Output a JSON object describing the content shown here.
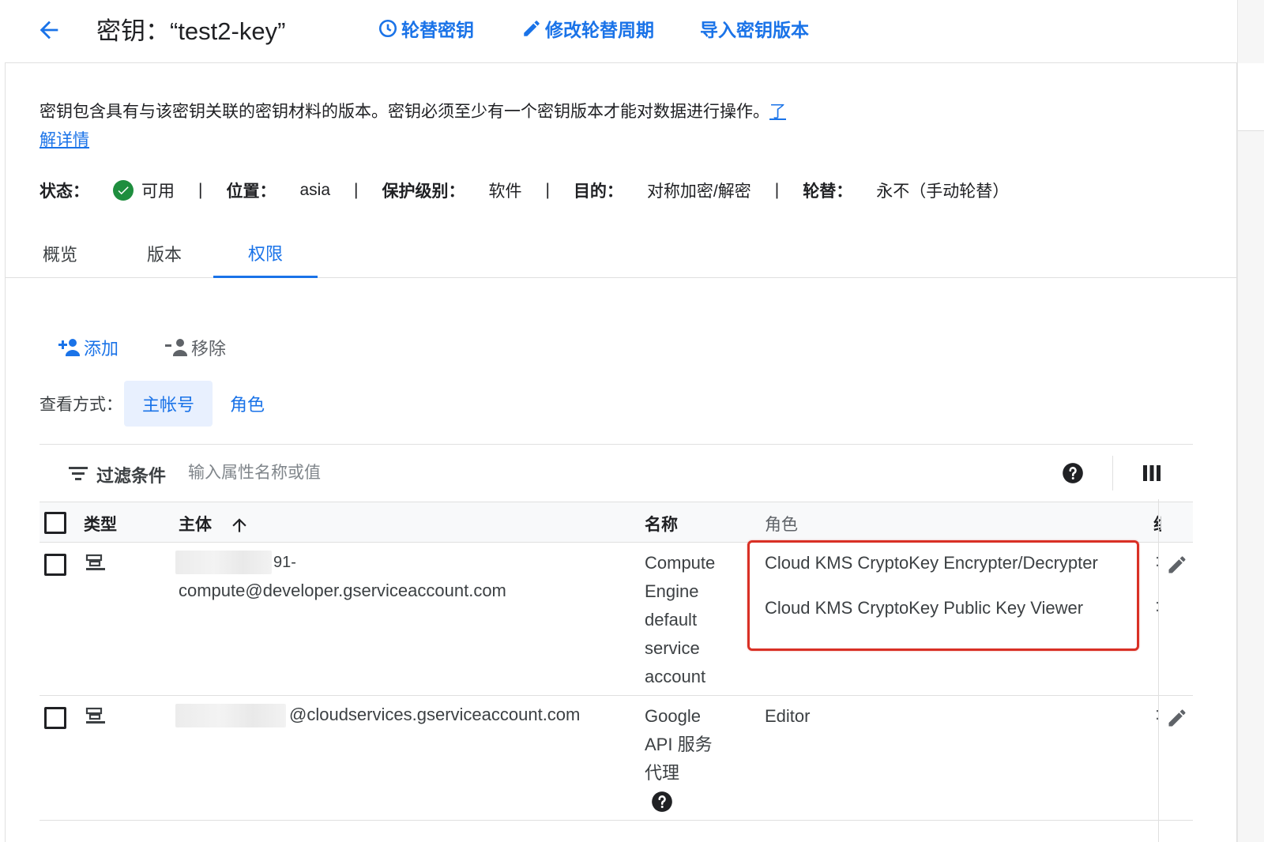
{
  "header": {
    "title": "密钥：“test2-key”",
    "rotate_label": "轮替密钥",
    "edit_period_label": "修改轮替周期",
    "import_label": "导入密钥版本"
  },
  "description": {
    "text": "密钥包含具有与该密钥关联的密钥材料的版本。密钥必须至少有一个密钥版本才能对数据进行操作。",
    "link": "了解详情"
  },
  "status": {
    "state_label": "状态：",
    "state_value": "可用",
    "location_label": "位置：",
    "location_value": "asia",
    "protection_label": "保护级别：",
    "protection_value": "软件",
    "purpose_label": "目的：",
    "purpose_value": "对称加密/解密",
    "rotation_label": "轮替：",
    "rotation_value": "永不（手动轮替）",
    "separator": "|"
  },
  "tabs": [
    {
      "label": "概览"
    },
    {
      "label": "版本"
    },
    {
      "label": "权限"
    }
  ],
  "toolbar": {
    "add_label": "添加",
    "remove_label": "移除"
  },
  "view_by": {
    "label": "查看方式：",
    "options": [
      {
        "label": "主帐号"
      },
      {
        "label": "角色"
      }
    ],
    "selected": "主帐号"
  },
  "filter": {
    "label": "过滤条件",
    "placeholder": "输入属性名称或值"
  },
  "table": {
    "headers": {
      "type": "类型",
      "principal": "主体",
      "name": "名称",
      "role": "角色",
      "clipped": "组"
    },
    "rows": [
      {
        "principal_line1": "91-",
        "principal_line2": "compute@developer.gserviceaccount.com",
        "name_lines": [
          "Compute",
          "Engine",
          "default",
          "service",
          "account"
        ],
        "roles": [
          "Cloud KMS CryptoKey Encrypter/Decrypter",
          "Cloud KMS CryptoKey Public Key Viewer"
        ]
      },
      {
        "principal_line1": "@cloudservices.gserviceaccount.com",
        "name_lines": [
          "Google",
          "API 服务",
          "代理"
        ],
        "roles": [
          "Editor"
        ]
      }
    ]
  },
  "colors": {
    "accent": "#1a73e8",
    "success": "#1e8e3e",
    "highlight": "#d93025",
    "selected_bg": "#e8f0fe"
  }
}
